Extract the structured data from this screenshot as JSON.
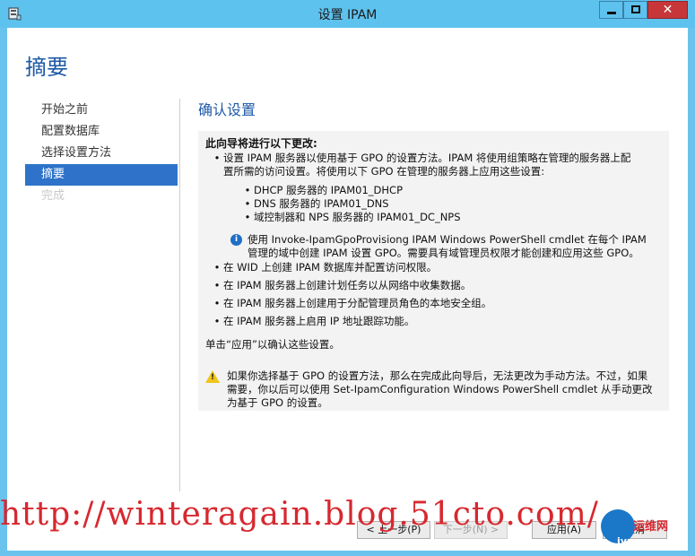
{
  "window": {
    "title": "设置 IPAM"
  },
  "page": {
    "title": "摘要"
  },
  "nav": {
    "items": [
      {
        "label": "开始之前"
      },
      {
        "label": "配置数据库"
      },
      {
        "label": "选择设置方法"
      },
      {
        "label": "摘要"
      },
      {
        "label": "完成"
      }
    ]
  },
  "content": {
    "section_title": "确认设置",
    "heading": "此向导将进行以下更改:",
    "bullet1": {
      "line1": "设置 IPAM 服务器以使用基于 GPO 的设置方法。IPAM 将使用组策略在管理的服务器上配",
      "line2": "置所需的访问设置。将使用以下 GPO 在管理的服务器上应用这些设置:"
    },
    "gpos": [
      "DHCP 服务器的 IPAM01_DHCP",
      "DNS 服务器的 IPAM01_DNS",
      "域控制器和 NPS 服务器的 IPAM01_DC_NPS"
    ],
    "info": {
      "line1": "使用 Invoke-IpamGpoProvisiong IPAM Windows PowerShell cmdlet 在每个 IPAM",
      "line2": "管理的域中创建 IPAM 设置 GPO。需要具有域管理员权限才能创建和应用这些 GPO。"
    },
    "bullets": [
      "在 WID 上创建 IPAM 数据库并配置访问权限。",
      "在 IPAM 服务器上创建计划任务以从网络中收集数据。",
      "在 IPAM 服务器上创建用于分配管理员角色的本地安全组。",
      "在 IPAM 服务器上启用 IP 地址跟踪功能。"
    ],
    "confirm": "单击“应用”以确认这些设置。",
    "warning": {
      "line1": "如果你选择基于 GPO 的设置方法，那么在完成此向导后，无法更改为手动方法。不过，如果",
      "line2": "需要，你以后可以使用 Set-IpamConfiguration Windows PowerShell cmdlet 从手动更改",
      "line3": "为基于 GPO 的设置。"
    }
  },
  "buttons": {
    "prev": "< 上一步(P)",
    "next": "下一步(N) >",
    "apply": "应用(A)",
    "cancel": "取消"
  },
  "watermark": {
    "text": "http://winteragain.blog.51cto.com/",
    "logo_line1": "运维网",
    "logo_line2": "iyunv.com"
  },
  "icons": {
    "app": "server-icon",
    "info": "info-icon",
    "warning": "warning-icon"
  },
  "colors": {
    "titlebar": "#5ec2ee",
    "accent": "#1e5aa6",
    "nav_active": "#2e73c9",
    "close": "#c7373a"
  }
}
